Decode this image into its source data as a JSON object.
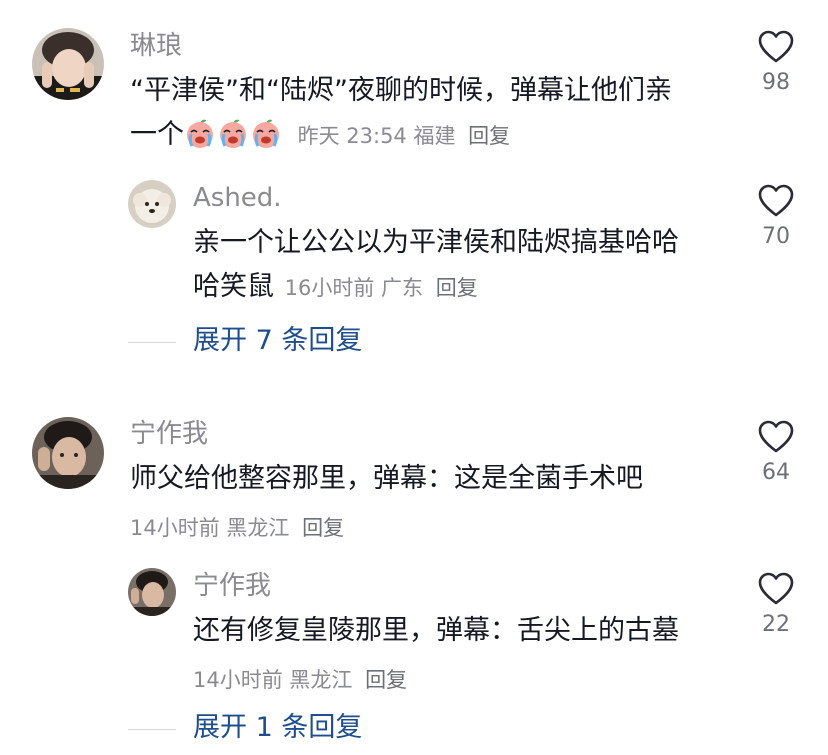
{
  "comments": [
    {
      "user": "琳琅",
      "text_line1": "“平津侯”和“陆烬”夜聊的时候，弹幕让他们亲",
      "text_line2": "一个",
      "emojis": [
        "crying-peach-emoji",
        "crying-peach-emoji",
        "crying-peach-emoji"
      ],
      "time": "昨天 23:54",
      "location": "福建",
      "reply_label": "回复",
      "likes": "98",
      "reply": {
        "user": "Ashed.",
        "text_line1": "亲一个让公公以为平津侯和陆烬搞基哈哈",
        "text_line2": "哈笑鼠",
        "time": "16小时前",
        "location": "广东",
        "reply_label": "回复",
        "likes": "70"
      },
      "expand_label": "展开 7 条回复"
    },
    {
      "user": "宁作我",
      "text_line1": "师父给他整容那里，弹幕：这是全菌手术吧",
      "time": "14小时前",
      "location": "黑龙江",
      "reply_label": "回复",
      "likes": "64",
      "reply": {
        "user": "宁作我",
        "text_line1": "还有修复皇陵那里，弹幕：舌尖上的古墓",
        "time": "14小时前",
        "location": "黑龙江",
        "reply_label": "回复",
        "likes": "22"
      },
      "expand_label": "展开 1 条回复"
    }
  ],
  "colors": {
    "username": "#8a8b91",
    "text": "#161823",
    "expand": "#1f4e8e",
    "heart_stroke": "#2a2b33"
  },
  "icons": {
    "like": "heart-outline-icon"
  }
}
